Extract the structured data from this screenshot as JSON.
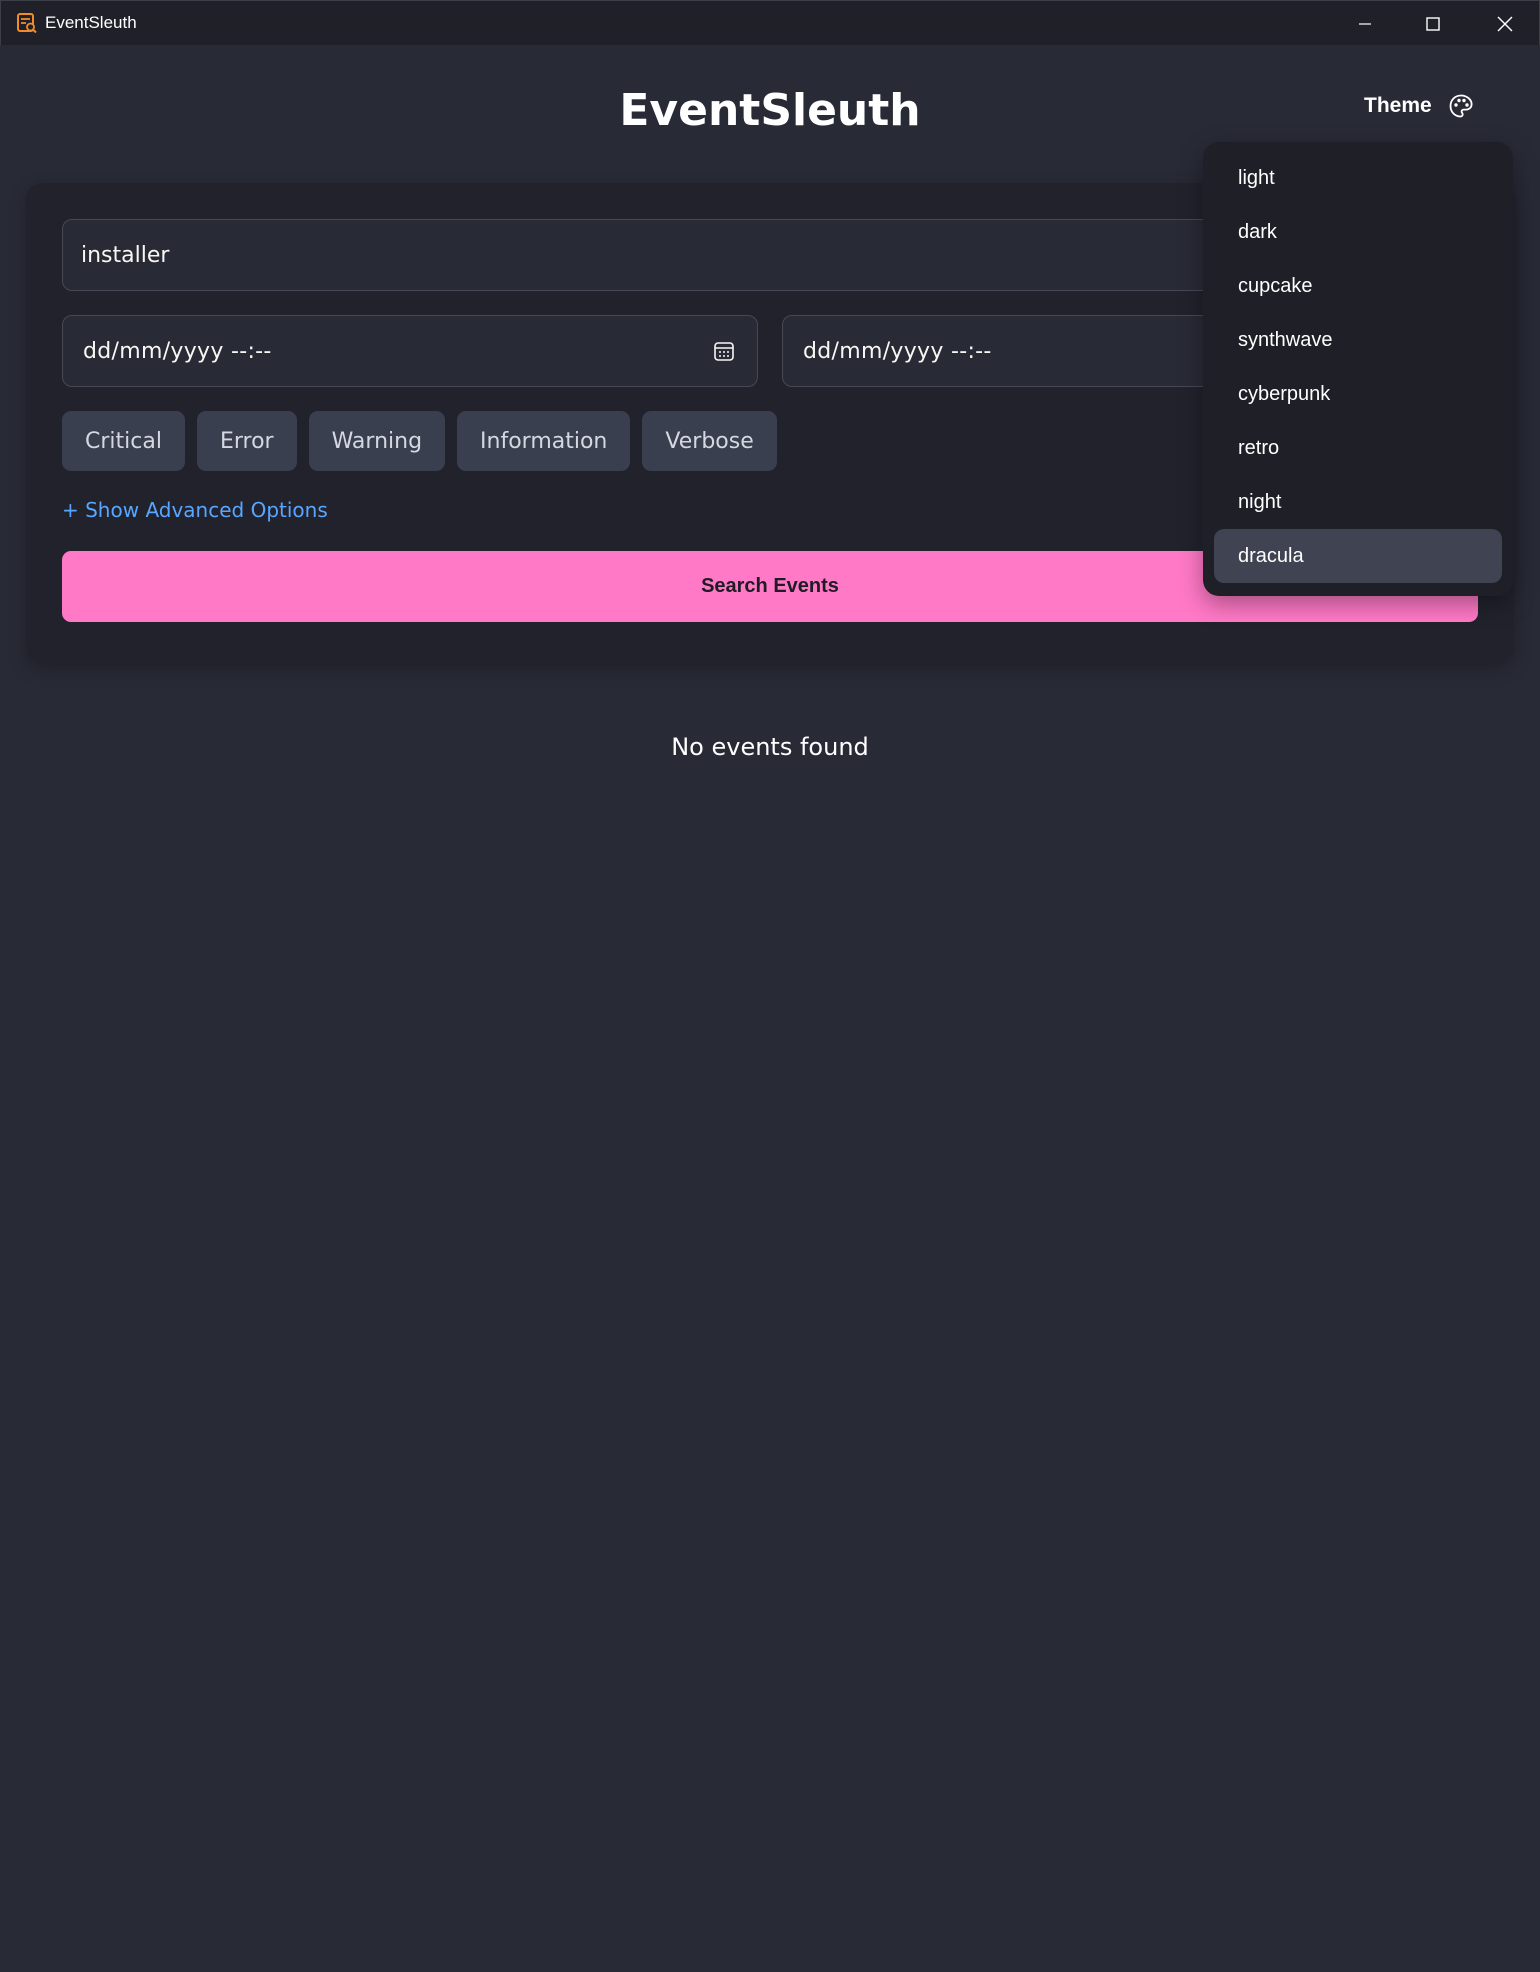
{
  "window": {
    "title": "EventSleuth",
    "icon": "app-search-log-icon",
    "accent_icon_color": "#f28c28"
  },
  "header": {
    "title": "EventSleuth",
    "theme_label": "Theme",
    "theme_icon": "palette-icon"
  },
  "search": {
    "query_value": "installer",
    "start_date_placeholder": "dd/mm/yyyy --:--",
    "end_date_placeholder": "dd/mm/yyyy --:--",
    "levels": [
      "Critical",
      "Error",
      "Warning",
      "Information",
      "Verbose"
    ],
    "advanced_link": "+ Show Advanced Options",
    "submit_label": "Search Events"
  },
  "results": {
    "empty_message": "No events found"
  },
  "theme_menu": {
    "items": [
      "light",
      "dark",
      "cupcake",
      "synthwave",
      "cyberpunk",
      "retro",
      "night",
      "dracula"
    ],
    "selected": "dracula"
  },
  "colors": {
    "background": "#282a36",
    "card": "#21222c",
    "primary": "#ff79c6",
    "link": "#58a6ff",
    "level_button": "#3a3f4f",
    "menu_active": "#3f4352"
  }
}
